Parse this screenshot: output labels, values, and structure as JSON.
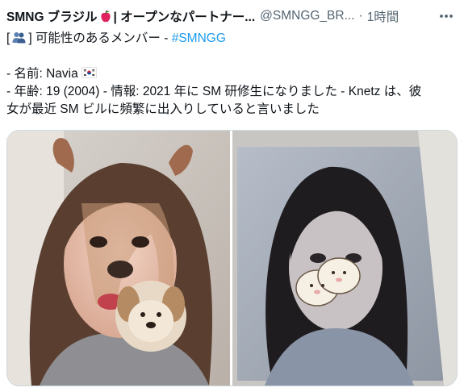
{
  "tweet": {
    "author_name_part1": "SMNG ブラジル",
    "author_name_part2": "| オープンなパートナー...",
    "handle": "@SMNGG_BR...",
    "separator": "·",
    "time": "1時間",
    "icons": {
      "brand": "apple-icon",
      "more": "more-icon",
      "people": "people-icon",
      "flag": "korea-flag-icon"
    },
    "text": {
      "line1_prefix": "[",
      "line1_middle": "] 可能性のあるメンバー -",
      "hashtag": "#SMNGG",
      "line2": "- 名前: Navia",
      "line3": "- 年齢: 19 (2004) - 情報: 2021 年に SM 研修生になりました - Knetz は、彼",
      "line4": "女が最近 SM ビルに頻繁に出入りしていると言いました"
    },
    "media": {
      "photos": [
        {
          "name": "selfie-with-dog-filter-photo"
        },
        {
          "name": "monitor-photo-with-stickers"
        }
      ]
    },
    "colors": {
      "text": "#0f1419",
      "secondary": "#536471",
      "link": "#1d9bf0",
      "border": "#cfd9de"
    }
  }
}
